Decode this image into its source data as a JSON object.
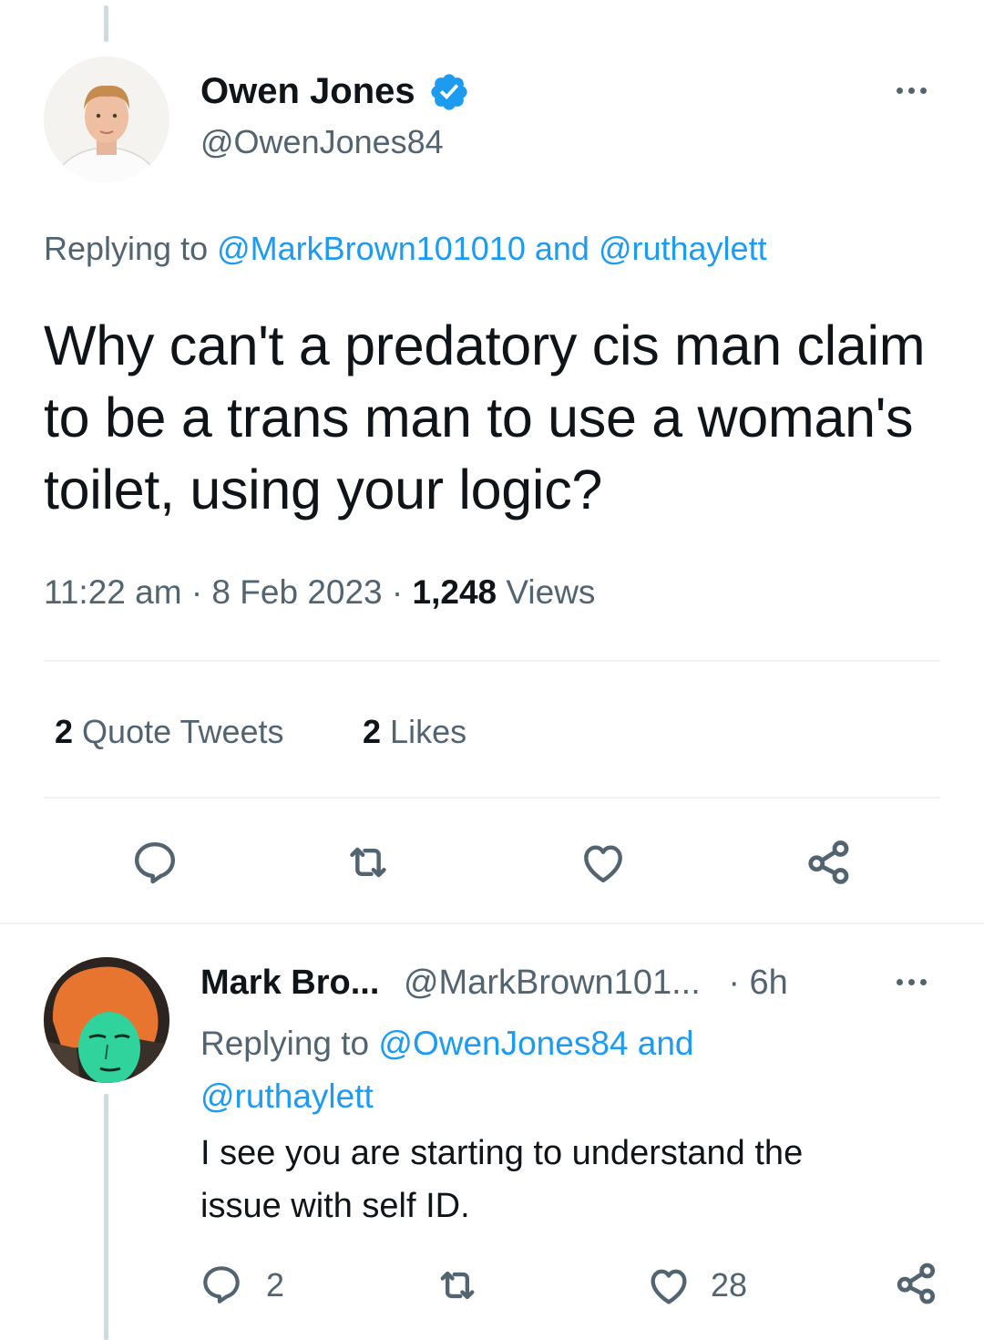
{
  "main_tweet": {
    "author_name": "Owen Jones",
    "author_handle": "@OwenJones84",
    "replying_prefix": "Replying to",
    "replying_user_1": "@MarkBrown101010",
    "replying_and": "and",
    "replying_user_2": "@ruthaylett",
    "text": "Why can't a predatory cis man claim to be a trans man to use a woman's toilet, using your logic?",
    "time": "11:22 am",
    "date": "8 Feb 2023",
    "views_count": "1,248",
    "views_label": "Views",
    "separator": "·",
    "quote_tweets_count": "2",
    "quote_tweets_label": "Quote Tweets",
    "likes_count": "2",
    "likes_label": "Likes"
  },
  "reply_tweet": {
    "author_name": "Mark Bro...",
    "author_handle": "@MarkBrown101...",
    "age": "· 6h",
    "replying_prefix": "Replying to",
    "replying_user_1": "@OwenJones84",
    "replying_and": "and",
    "replying_user_2": "@ruthaylett",
    "text_line_1": "I see you are starting to understand the",
    "text_line_2": "issue with self ID.",
    "reply_count": "2",
    "like_count": "28"
  },
  "colors": {
    "accent": "#1d9bf0",
    "muted_text": "#536471",
    "divider": "#eff3f4",
    "thread_line": "#cfd9de",
    "verified_badge": "#1d9bf0"
  },
  "icons": {
    "verified": "verified-badge-icon",
    "more": "more-dots-icon",
    "reply": "reply-icon",
    "retweet": "retweet-icon",
    "like": "heart-icon",
    "share": "share-icon"
  }
}
